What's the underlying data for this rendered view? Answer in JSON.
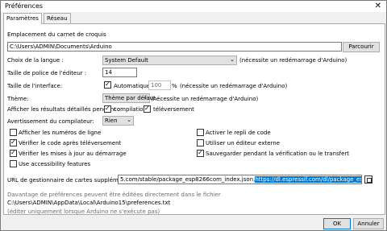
{
  "window": {
    "title": "Préférences",
    "close_glyph": "✕"
  },
  "tabs": [
    {
      "label": "Paramètres",
      "active": true
    },
    {
      "label": "Réseau",
      "active": false
    }
  ],
  "sketchbook": {
    "label": "Emplacement du carnet de croquis",
    "path": "C:\\Users\\ADMIN\\Documents\\Arduino",
    "browse_label": "Parcourir"
  },
  "language": {
    "label": "Choix de la langue :",
    "value": "System Default",
    "note": "(nécessite un redémarrage d'Arduino)"
  },
  "font_size": {
    "label": "Taille de police de l'éditeur :",
    "value": "14"
  },
  "interface_size": {
    "label": "Taille de l'interface:",
    "auto_label": "Automatique",
    "auto_checked": true,
    "value": "100",
    "unit": "%",
    "note": "(nécessite un redémarrage d'Arduino)"
  },
  "theme": {
    "label": "Thème:",
    "value": "Thème par défaut",
    "note": "(nécessite un redémarrage d'Arduino)"
  },
  "verbose": {
    "label": "Afficher les résultats détaillés pendant :",
    "compile_label": "compilation",
    "compile_checked": true,
    "upload_label": "téléversement",
    "upload_checked": true
  },
  "warnings": {
    "label": "Avertissement du compilateur:",
    "value": "Rien"
  },
  "options_left": [
    {
      "label": "Afficher les numéros de ligne",
      "checked": false
    },
    {
      "label": "Vérifier le code après téléversement",
      "checked": true
    },
    {
      "label": "Vérifier les mises à jour au démarrage",
      "checked": true
    },
    {
      "label": "Use accessibility features",
      "checked": false
    }
  ],
  "options_right": [
    {
      "label": "Activer le repli de code",
      "checked": false
    },
    {
      "label": "Utiliser un éditeur externe",
      "checked": false
    },
    {
      "label": "Sauvegarder pendant la vérification ou le transfert",
      "checked": true
    }
  ],
  "board_urls": {
    "label": "URL de gestionnaire de cartes supplémentaires",
    "value_plain": "5.com/stable/package_esp8266com_index.json,",
    "value_selected": "https://dl.espressif.com/dl/package_esp32_index.json"
  },
  "footer": {
    "note": "Davantage de préférences peuvent être éditées directement dans le fichier",
    "path": "C:\\Users\\ADMIN\\AppData\\Local\\Arduino15\\preferences.txt",
    "hint": "(éditer uniquement lorsque Arduino ne s'exécute pas)"
  },
  "buttons": {
    "ok": "OK",
    "cancel": "Annuler"
  }
}
